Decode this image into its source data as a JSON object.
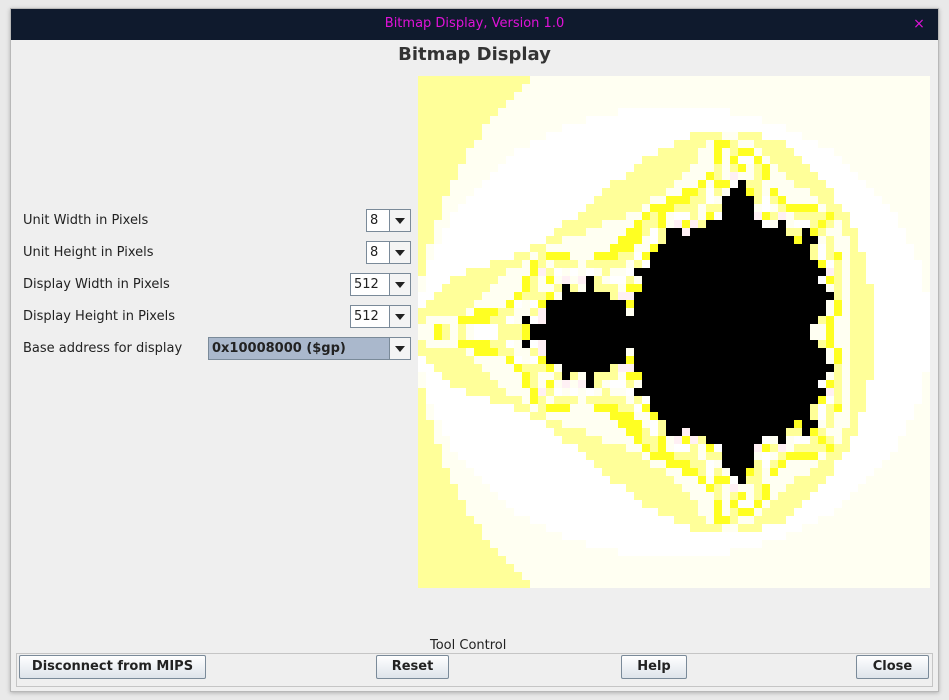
{
  "window": {
    "title": "Bitmap Display, Version 1.0",
    "close_glyph": "×"
  },
  "heading": "Bitmap Display",
  "settings": [
    {
      "label": "Unit Width in Pixels",
      "value": "8"
    },
    {
      "label": "Unit Height in Pixels",
      "value": "8"
    },
    {
      "label": "Display Width in Pixels",
      "value": "512"
    },
    {
      "label": "Display Height in Pixels",
      "value": "512"
    },
    {
      "label": "Base address for display",
      "value": "0x10008000 ($gp)"
    }
  ],
  "bitmap": {
    "content": "mandelbrot-set",
    "colors": {
      "inside": "#000000",
      "bright": "#ffff22",
      "mid": "#ffff99",
      "pale": "#fffff2",
      "white": "#ffffff",
      "pink": "#fff0f4"
    }
  },
  "tool_control": {
    "label": "Tool Control",
    "disconnect": "Disconnect from MIPS",
    "reset": "Reset",
    "help": "Help",
    "close": "Close"
  },
  "colors": {
    "titlebar_bg": "#0f1a2d",
    "title_text": "#e012d8",
    "selected_combo": "#aab8cc"
  }
}
